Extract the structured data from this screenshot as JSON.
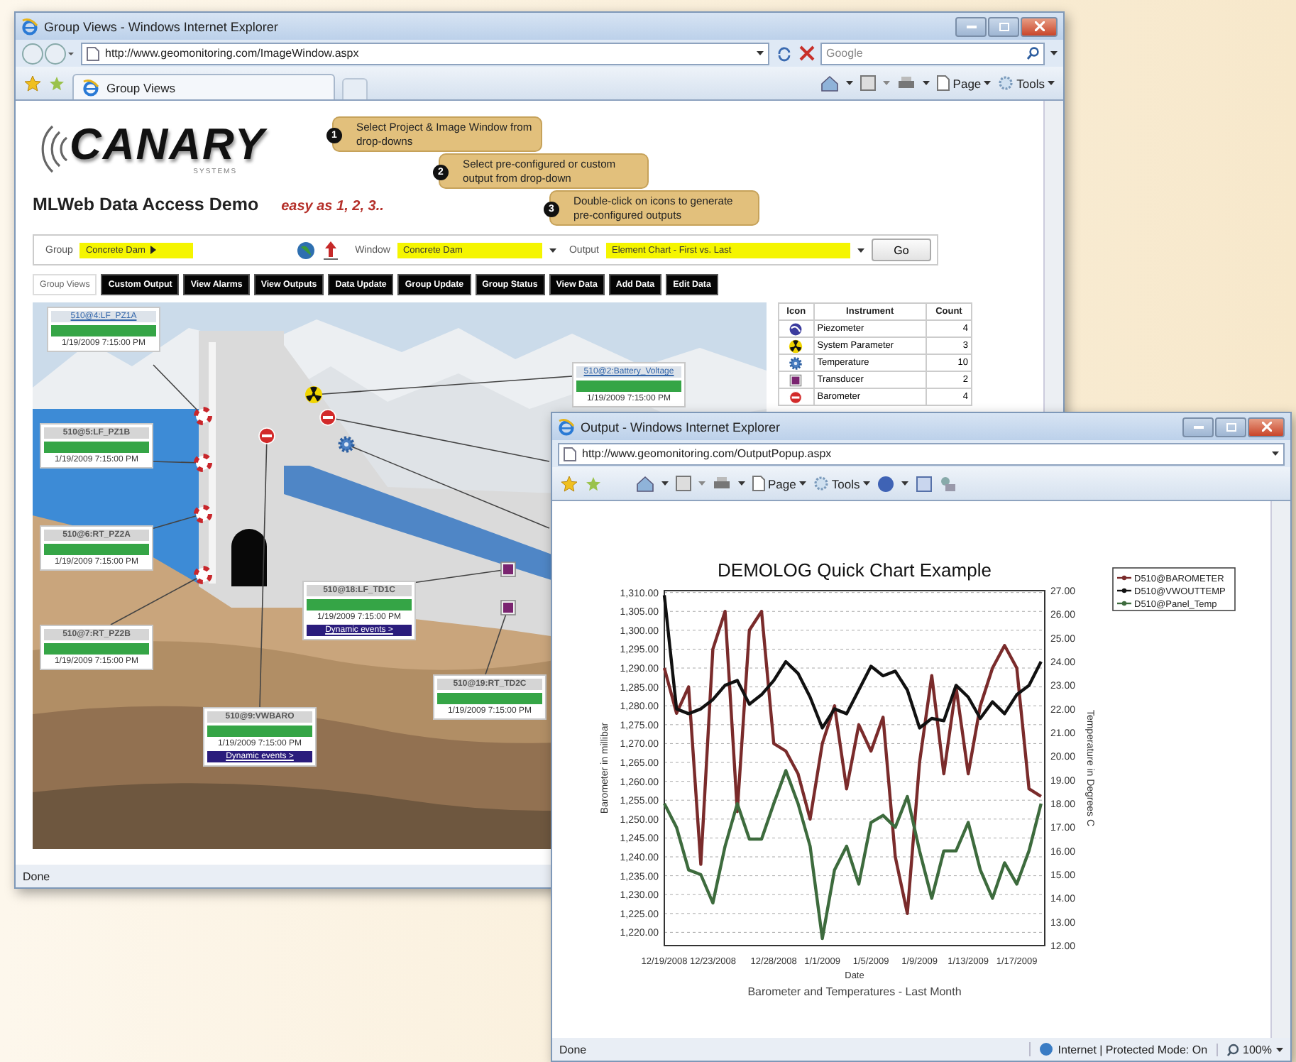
{
  "group_window": {
    "title": "Group Views - Windows Internet Explorer",
    "address": "http://www.geomonitoring.com/ImageWindow.aspx",
    "search_placeholder": "Google",
    "tab_title": "Group Views",
    "commands": [
      "Page",
      "Tools"
    ],
    "status": "Done",
    "page": {
      "logo": {
        "name": "CANARY",
        "subtitle": "SYSTEMS"
      },
      "heading": "MLWeb Data Access Demo",
      "tagline": "easy as 1, 2, 3..",
      "callouts": [
        {
          "number": "1",
          "text": "Select Project & Image Window from drop-downs"
        },
        {
          "number": "2",
          "text": "Select pre-configured or custom output from drop-down"
        },
        {
          "number": "3",
          "text": "Double-click on icons to generate pre-configured outputs"
        }
      ],
      "form": {
        "group": {
          "label": "Group",
          "value": "Concrete Dam"
        },
        "window": {
          "label": "Window",
          "value": "Concrete Dam"
        },
        "output": {
          "label": "Output",
          "value": "Element Chart - First vs. Last"
        },
        "go": "Go"
      },
      "tabs": [
        {
          "label": "Group Views",
          "selected": true
        },
        {
          "label": "Custom Output",
          "selected": false
        },
        {
          "label": "View Alarms",
          "selected": false
        },
        {
          "label": "View Outputs",
          "selected": false
        },
        {
          "label": "Data Update",
          "selected": false
        },
        {
          "label": "Group Update",
          "selected": false
        },
        {
          "label": "Group Status",
          "selected": false
        },
        {
          "label": "View Data",
          "selected": false
        },
        {
          "label": "Add Data",
          "selected": false
        },
        {
          "label": "Edit Data",
          "selected": false
        }
      ],
      "map": {
        "boxes": [
          {
            "label": "510@4:LF_PZ1A",
            "link": true,
            "date": "1/19/2009 7:15:00 PM"
          },
          {
            "label": "510@2:Battery_Voltage",
            "link": true,
            "date": "1/19/2009 7:15:00 PM"
          },
          {
            "label": "510@5:LF_PZ1B",
            "link": false,
            "date": "1/19/2009 7:15:00 PM"
          },
          {
            "label": "510@6:RT_PZ2A",
            "link": false,
            "date": "1/19/2009 7:15:00 PM"
          },
          {
            "label": "510@7:RT_PZ2B",
            "link": false,
            "date": "1/19/2009 7:15:00 PM"
          },
          {
            "label": "510@18:LF_TD1C",
            "link": false,
            "date": "1/19/2009 7:15:00 PM",
            "events": "Dynamic events >"
          },
          {
            "label": "510@9:VWBARO",
            "link": false,
            "date": "1/19/2009 7:15:00 PM",
            "events": "Dynamic events >"
          },
          {
            "label": "510@19:RT_TD2C",
            "link": false,
            "date": "1/19/2009 7:15:00 PM"
          }
        ],
        "sensors": [
          {
            "kind": "alarm"
          },
          {
            "kind": "alarm"
          },
          {
            "kind": "alarm"
          },
          {
            "kind": "alarm"
          },
          {
            "kind": "system_parameter"
          },
          {
            "kind": "barometer"
          },
          {
            "kind": "barometer"
          },
          {
            "kind": "temperature"
          },
          {
            "kind": "transducer"
          },
          {
            "kind": "transducer"
          }
        ]
      },
      "legend": {
        "columns": [
          "Icon",
          "Instrument",
          "Count"
        ],
        "rows": [
          {
            "kind": "piezometer",
            "instrument": "Piezometer",
            "count": "4"
          },
          {
            "kind": "system_parameter",
            "instrument": "System Parameter",
            "count": "3"
          },
          {
            "kind": "temperature",
            "instrument": "Temperature",
            "count": "10"
          },
          {
            "kind": "transducer",
            "instrument": "Transducer",
            "count": "2"
          },
          {
            "kind": "barometer",
            "instrument": "Barometer",
            "count": "4"
          }
        ]
      }
    }
  },
  "output_window": {
    "title": "Output - Windows Internet Explorer",
    "address": "http://www.geomonitoring.com/OutputPopup.aspx",
    "commands": [
      "Page",
      "Tools"
    ],
    "status": "Done",
    "zone": "Internet | Protected Mode: On",
    "zoom": "100%",
    "chart_data": {
      "type": "line",
      "grid": true,
      "legend": true,
      "title": "DEMOLOG Quick Chart Example",
      "xlabel": "Date",
      "ylabel": "Barometer in millibar",
      "y2label": "Temperature in Degrees C",
      "subtitle": "Barometer and Temperatures - Last Month",
      "categories": [
        "12/19/2008",
        null,
        null,
        null,
        "12/23/2008",
        null,
        null,
        null,
        null,
        "12/28/2008",
        null,
        null,
        null,
        "1/1/2009",
        null,
        null,
        null,
        "1/5/2009",
        null,
        null,
        null,
        "1/9/2009",
        null,
        null,
        null,
        "1/13/2009",
        null,
        null,
        null,
        "1/17/2009",
        null,
        null
      ],
      "ylim": [
        1216.5,
        1310.5
      ],
      "yticks": [
        {
          "value": 1220,
          "label": "1,220.00"
        },
        {
          "value": 1225,
          "label": "1,225.00"
        },
        {
          "value": 1230,
          "label": "1,230.00"
        },
        {
          "value": 1235,
          "label": "1,235.00"
        },
        {
          "value": 1240,
          "label": "1,240.00"
        },
        {
          "value": 1245,
          "label": "1,245.00"
        },
        {
          "value": 1250,
          "label": "1,250.00"
        },
        {
          "value": 1255,
          "label": "1,255.00"
        },
        {
          "value": 1260,
          "label": "1,260.00"
        },
        {
          "value": 1265,
          "label": "1,265.00"
        },
        {
          "value": 1270,
          "label": "1,270.00"
        },
        {
          "value": 1275,
          "label": "1,275.00"
        },
        {
          "value": 1280,
          "label": "1,280.00"
        },
        {
          "value": 1285,
          "label": "1,285.00"
        },
        {
          "value": 1290,
          "label": "1,290.00"
        },
        {
          "value": 1295,
          "label": "1,295.00"
        },
        {
          "value": 1300,
          "label": "1,300.00"
        },
        {
          "value": 1305,
          "label": "1,305.00"
        },
        {
          "value": 1310,
          "label": "1,310.00"
        }
      ],
      "y2lim": [
        12,
        27
      ],
      "y2ticks": [
        {
          "value": 12,
          "label": "12.00"
        },
        {
          "value": 13,
          "label": "13.00"
        },
        {
          "value": 14,
          "label": "14.00"
        },
        {
          "value": 15,
          "label": "15.00"
        },
        {
          "value": 16,
          "label": "16.00"
        },
        {
          "value": 17,
          "label": "17.00"
        },
        {
          "value": 18,
          "label": "18.00"
        },
        {
          "value": 19,
          "label": "19.00"
        },
        {
          "value": 20,
          "label": "20.00"
        },
        {
          "value": 21,
          "label": "21.00"
        },
        {
          "value": 22,
          "label": "22.00"
        },
        {
          "value": 23,
          "label": "23.00"
        },
        {
          "value": 24,
          "label": "24.00"
        },
        {
          "value": 25,
          "label": "25.00"
        },
        {
          "value": 26,
          "label": "26.00"
        },
        {
          "value": 27,
          "label": "27.00"
        }
      ],
      "series": [
        {
          "name": "D510@BAROMETER",
          "color": "#7a2b2b",
          "values": [
            1290,
            1278,
            1285,
            1238,
            1295,
            1305,
            1252,
            1300,
            1305,
            1270,
            1268,
            1262,
            1250,
            1270,
            1280,
            1258,
            1275,
            1268,
            1277,
            1240,
            1225,
            1265,
            1288,
            1262,
            1285,
            1262,
            1280,
            1290,
            1296,
            1290,
            1258,
            1256
          ]
        },
        {
          "name": "D510@VWOUTTEMP",
          "color": "#111111",
          "axis": "y2",
          "values": [
            26.8,
            22.0,
            21.8,
            22.0,
            22.4,
            23.0,
            23.2,
            22.2,
            22.6,
            23.2,
            24.0,
            23.5,
            22.5,
            21.2,
            22.0,
            21.8,
            22.8,
            23.8,
            23.4,
            23.6,
            22.8,
            21.2,
            21.6,
            21.5,
            23.0,
            22.5,
            21.6,
            22.3,
            21.8,
            22.6,
            23.0,
            24.0
          ]
        },
        {
          "name": "D510@Panel_Temp",
          "color": "#3d6b3d",
          "axis": "y2",
          "values": [
            18.0,
            17.0,
            15.2,
            15.0,
            13.8,
            16.2,
            18.0,
            16.5,
            16.5,
            18.0,
            19.4,
            18.0,
            16.2,
            12.3,
            15.2,
            16.2,
            14.6,
            17.2,
            17.5,
            17.0,
            18.3,
            16.0,
            14.0,
            16.0,
            16.0,
            17.2,
            15.2,
            14.0,
            15.5,
            14.6,
            16.0,
            18.0
          ]
        }
      ]
    }
  }
}
